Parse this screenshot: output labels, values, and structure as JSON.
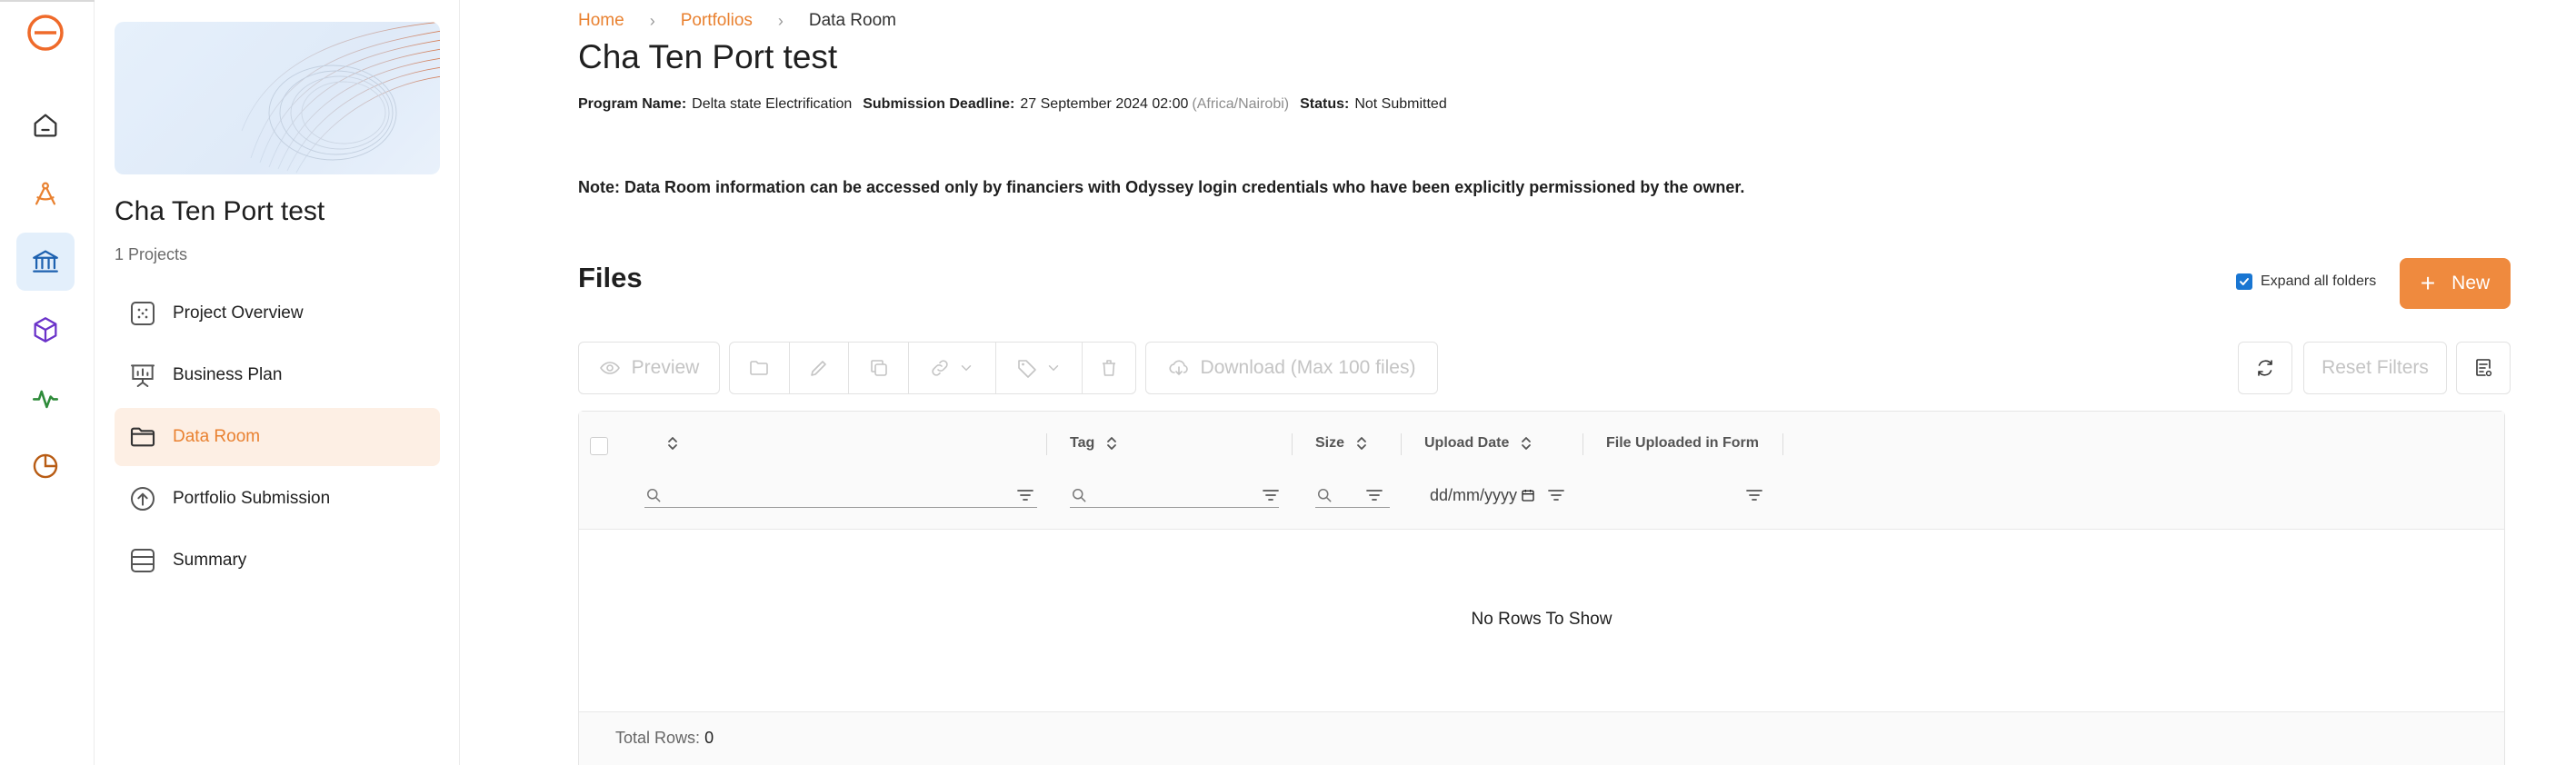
{
  "rail": {
    "items": [
      {
        "name": "home",
        "icon": "home-icon",
        "color": "#333333"
      },
      {
        "name": "compass",
        "icon": "compass-icon",
        "color": "#e98130"
      },
      {
        "name": "bank",
        "icon": "bank-icon",
        "color": "#1e62b0"
      },
      {
        "name": "package",
        "icon": "package-icon",
        "color": "#6a32c9"
      },
      {
        "name": "activity",
        "icon": "activity-icon",
        "color": "#2e8b3a"
      },
      {
        "name": "pie",
        "icon": "pie-chart-icon",
        "color": "#b85c14"
      }
    ]
  },
  "sidebar": {
    "title": "Cha Ten Port test",
    "count": "1 Projects",
    "items": [
      {
        "label": "Project Overview",
        "icon": "grid-dots-icon"
      },
      {
        "label": "Business Plan",
        "icon": "presentation-icon"
      },
      {
        "label": "Data Room",
        "icon": "folder-icon"
      },
      {
        "label": "Portfolio Submission",
        "icon": "upload-circle-icon"
      },
      {
        "label": "Summary",
        "icon": "list-icon"
      }
    ]
  },
  "breadcrumb": {
    "home": "Home",
    "portfolios": "Portfolios",
    "current": "Data Room"
  },
  "page": {
    "title": "Cha Ten Port test",
    "program_label": "Program Name:",
    "program_value": "Delta state Electrification",
    "deadline_label": "Submission Deadline:",
    "deadline_value": "27 September 2024 02:00",
    "deadline_tz": "(Africa/Nairobi)",
    "status_label": "Status:",
    "status_value": "Not Submitted",
    "note": "Note: Data Room information can be accessed only by financiers with Odyssey login credentials who have been explicitly permissioned by the owner."
  },
  "files": {
    "title": "Files",
    "expand_label": "Expand all folders",
    "expand_checked": true,
    "new_label": "New"
  },
  "toolbar": {
    "preview": "Preview",
    "download": "Download (Max 100 files)",
    "reset": "Reset Filters"
  },
  "grid": {
    "columns": {
      "tag": "Tag",
      "size": "Size",
      "upload_date": "Upload Date",
      "form": "File Uploaded in Form"
    },
    "date_placeholder": "dd/mm/yyyy",
    "empty": "No Rows To Show",
    "total_label": "Total Rows:",
    "total_value": "0"
  },
  "colors": {
    "accent": "#ef8a3e",
    "link": "#e98130",
    "active_rail": "#e3effb",
    "active_nav": "#fdefe4",
    "checkbox": "#1976d2"
  }
}
